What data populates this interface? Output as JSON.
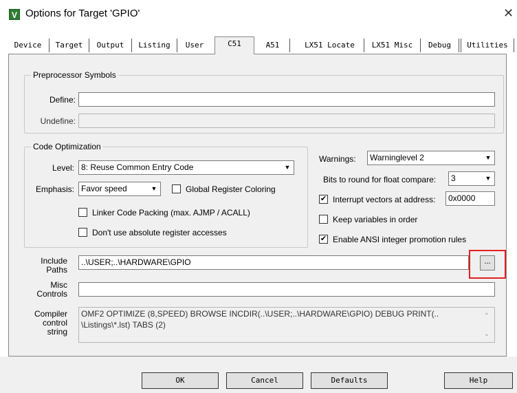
{
  "window": {
    "title": "Options for Target 'GPIO'",
    "icon_letter": "V",
    "close_glyph": "✕"
  },
  "tabs": [
    {
      "label": "Device"
    },
    {
      "label": "Target"
    },
    {
      "label": "Output"
    },
    {
      "label": "Listing"
    },
    {
      "label": "User"
    },
    {
      "label": "C51"
    },
    {
      "label": "A51"
    },
    {
      "label": "LX51 Locate"
    },
    {
      "label": "LX51 Misc"
    },
    {
      "label": "Debug"
    },
    {
      "label": "Utilities"
    }
  ],
  "active_tab": "C51",
  "preprocessor": {
    "title": "Preprocessor Symbols",
    "define_label": "Define:",
    "define_value": "",
    "undefine_label": "Undefine:",
    "undefine_value": ""
  },
  "optimization": {
    "title": "Code Optimization",
    "level_label": "Level:",
    "level_value": "8: Reuse Common Entry Code",
    "emphasis_label": "Emphasis:",
    "emphasis_value": "Favor speed",
    "global_register_coloring": {
      "label": "Global Register Coloring",
      "checked": false
    },
    "linker_code_packing": {
      "label": "Linker Code Packing (max. AJMP / ACALL)",
      "checked": false
    },
    "no_absolute_register": {
      "label": "Don't use absolute register accesses",
      "checked": false
    }
  },
  "right_options": {
    "warnings_label": "Warnings:",
    "warnings_value": "Warninglevel 2",
    "bits_label": "Bits to round for float compare:",
    "bits_value": "3",
    "interrupt_vectors": {
      "label": "Interrupt vectors at address:",
      "checked": true,
      "value": "0x0000"
    },
    "keep_variables": {
      "label": "Keep variables in order",
      "checked": false
    },
    "ansi_integer": {
      "label": "Enable ANSI integer promotion rules",
      "checked": true
    }
  },
  "include_paths": {
    "label_line1": "Include",
    "label_line2": "Paths",
    "value": "..\\USER;..\\HARDWARE\\GPIO",
    "browse_label": "..."
  },
  "misc_controls": {
    "label_line1": "Misc",
    "label_line2": "Controls",
    "value": ""
  },
  "compiler_string": {
    "label_line1": "Compiler",
    "label_line2": "control",
    "label_line3": "string",
    "line1": "OMF2 OPTIMIZE (8,SPEED) BROWSE INCDIR(..\\USER;..\\HARDWARE\\GPIO) DEBUG PRINT(..",
    "line2": "\\Listings\\*.lst) TABS (2)"
  },
  "buttons": {
    "ok": "OK",
    "cancel": "Cancel",
    "defaults": "Defaults",
    "help": "Help"
  },
  "colors": {
    "highlight_box": "#e21f1f",
    "panel_bg": "#f0f0f0"
  }
}
